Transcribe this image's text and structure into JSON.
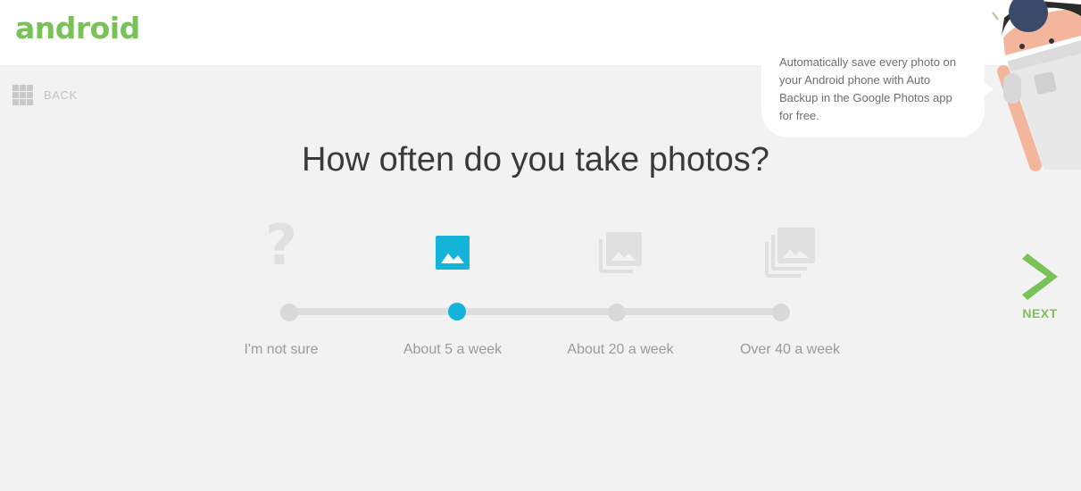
{
  "brand": {
    "logo_text": "android",
    "color": "#78c257"
  },
  "nav": {
    "back_label": "BACK",
    "next_label": "NEXT"
  },
  "question": "How often do you take photos?",
  "options": [
    {
      "label": "I'm not sure",
      "icon": "question-mark-icon",
      "glyph": "?",
      "selected": false
    },
    {
      "label": "About 5 a week",
      "icon": "single-photo-icon",
      "selected": true
    },
    {
      "label": "About 20 a week",
      "icon": "photo-stack-icon",
      "selected": false
    },
    {
      "label": "Over 40 a week",
      "icon": "large-photo-stack-icon",
      "selected": false
    }
  ],
  "tooltip": "Automatically save every photo on your Android phone with Auto Backup in the Google Photos app for free.",
  "colors": {
    "accent": "#14b3d9",
    "inactive": "#d9d9d9",
    "background": "#f2f2f2",
    "next_arrow": "#78c257"
  }
}
